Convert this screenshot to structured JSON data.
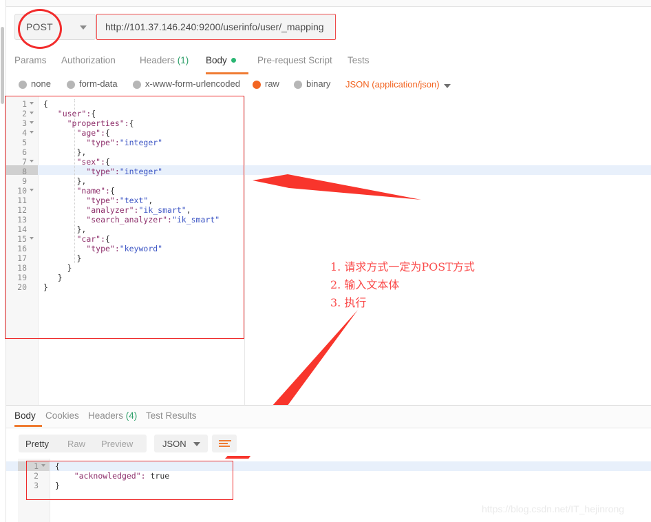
{
  "request": {
    "method": "POST",
    "url": "http://101.37.146.240:9200/userinfo/user/_mapping",
    "tabs": [
      {
        "label": "Params",
        "active": false
      },
      {
        "label": "Authorization",
        "active": false
      },
      {
        "label": "Headers",
        "count": "(1)",
        "active": false
      },
      {
        "label": "Body",
        "active": true
      },
      {
        "label": "Pre-request Script",
        "active": false
      },
      {
        "label": "Tests",
        "active": false
      }
    ],
    "body_types": [
      {
        "label": "none",
        "selected": false
      },
      {
        "label": "form-data",
        "selected": false
      },
      {
        "label": "x-www-form-urlencoded",
        "selected": false
      },
      {
        "label": "raw",
        "selected": true
      },
      {
        "label": "binary",
        "selected": false
      }
    ],
    "content_type": "JSON (application/json)",
    "body_lines": [
      {
        "n": "1",
        "fold": true,
        "text": "{"
      },
      {
        "n": "2",
        "fold": true,
        "text": "   \"user\":{"
      },
      {
        "n": "3",
        "fold": true,
        "text": "     \"properties\":{"
      },
      {
        "n": "4",
        "fold": true,
        "text": "       \"age\":{"
      },
      {
        "n": "5",
        "fold": false,
        "text": "         \"type\":\"integer\""
      },
      {
        "n": "6",
        "fold": false,
        "text": "       },"
      },
      {
        "n": "7",
        "fold": true,
        "text": "       \"sex\":{"
      },
      {
        "n": "8",
        "fold": false,
        "text": "         \"type\":\"integer\"",
        "highlight": true
      },
      {
        "n": "9",
        "fold": false,
        "text": "       },"
      },
      {
        "n": "10",
        "fold": true,
        "text": "       \"name\":{"
      },
      {
        "n": "11",
        "fold": false,
        "text": "         \"type\":\"text\","
      },
      {
        "n": "12",
        "fold": false,
        "text": "         \"analyzer\":\"ik_smart\","
      },
      {
        "n": "13",
        "fold": false,
        "text": "         \"search_analyzer\":\"ik_smart\""
      },
      {
        "n": "14",
        "fold": false,
        "text": "       },"
      },
      {
        "n": "15",
        "fold": true,
        "text": "       \"car\":{"
      },
      {
        "n": "16",
        "fold": false,
        "text": "         \"type\":\"keyword\""
      },
      {
        "n": "17",
        "fold": false,
        "text": "       }"
      },
      {
        "n": "18",
        "fold": false,
        "text": "     }"
      },
      {
        "n": "19",
        "fold": false,
        "text": "   }"
      },
      {
        "n": "20",
        "fold": false,
        "text": "}"
      }
    ]
  },
  "annotations": {
    "note_lines": "1. 请求方式一定为POST方式\n2. 输入文本体\n3. 执行",
    "color": "#fa4a4a"
  },
  "response": {
    "tabs": [
      {
        "label": "Body",
        "active": true
      },
      {
        "label": "Cookies",
        "active": false
      },
      {
        "label": "Headers",
        "count": "(4)",
        "active": false
      },
      {
        "label": "Test Results",
        "active": false
      }
    ],
    "view_modes": [
      {
        "label": "Pretty",
        "active": true
      },
      {
        "label": "Raw",
        "active": false
      },
      {
        "label": "Preview",
        "active": false
      }
    ],
    "format": "JSON",
    "body_lines": [
      {
        "n": "1",
        "fold": true,
        "text": "{",
        "highlight": true
      },
      {
        "n": "2",
        "fold": false,
        "text": "    \"acknowledged\": true"
      },
      {
        "n": "3",
        "fold": false,
        "text": "}"
      }
    ]
  },
  "watermark": "https://blog.csdn.net/IT_hejinrong",
  "colors": {
    "accent_orange": "#ef7b32",
    "annotation_red": "#ee2b2b",
    "green": "#2bb673",
    "radio_selected": "#f26522",
    "highlight_row": "#e8f0fb"
  }
}
